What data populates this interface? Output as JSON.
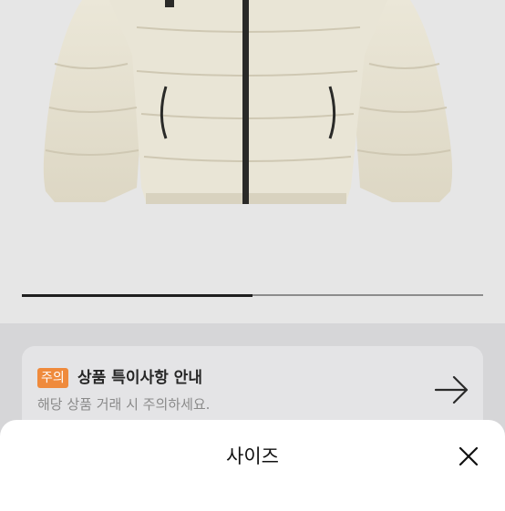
{
  "carousel": {
    "progress": 0.5
  },
  "notice": {
    "badge": "주의",
    "title": "상품 특이사항 안내",
    "description": "해당 상품 거래 시 주의하세요.",
    "arrow_icon": "arrow-right-icon"
  },
  "sheet": {
    "title": "사이즈",
    "close_icon": "close-icon"
  },
  "colors": {
    "badge": "#ef8a3c",
    "jacket": "#e8e3d4",
    "zipper": "#2a2a28"
  }
}
